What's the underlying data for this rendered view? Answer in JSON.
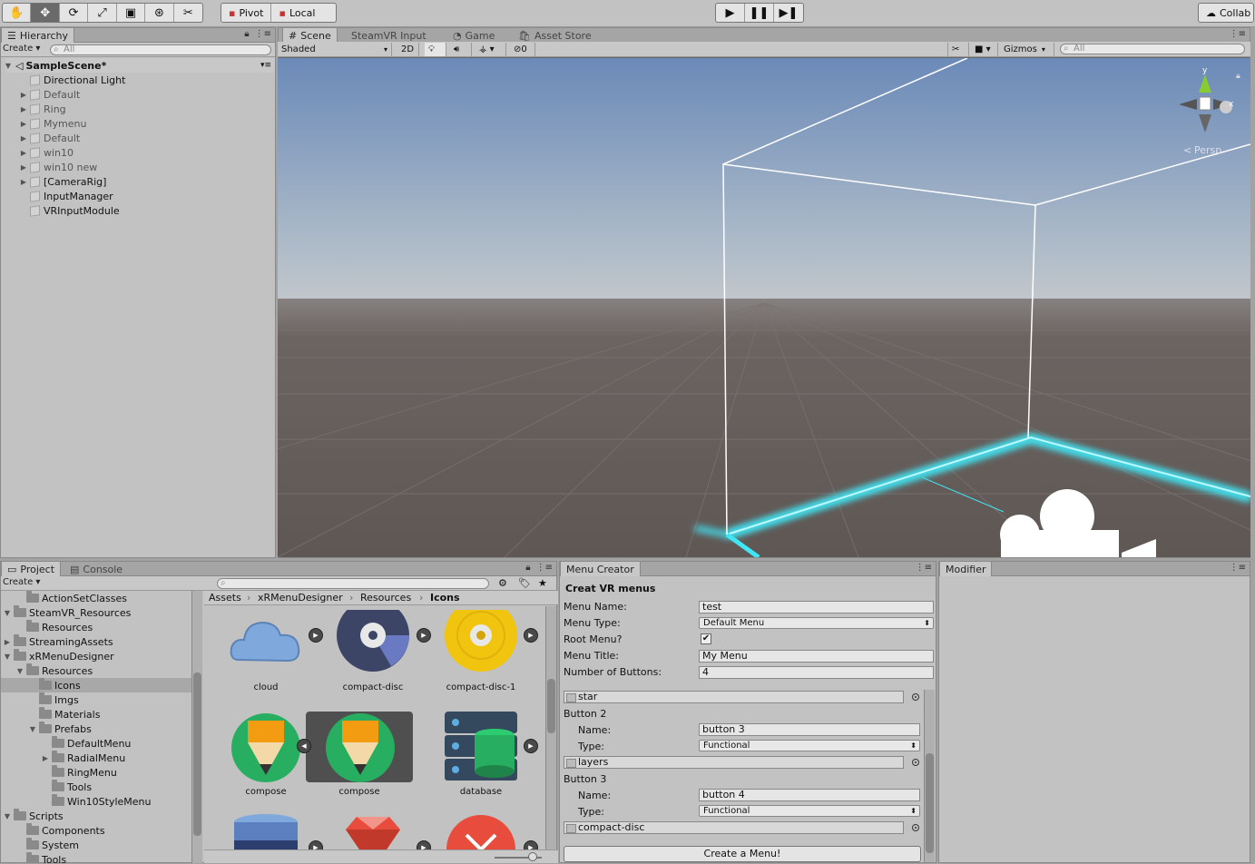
{
  "toolbar": {
    "tools": [
      "hand-tool",
      "move-tool",
      "rotate-tool",
      "scale-tool",
      "rect-tool",
      "transform-tool",
      "custom-tool"
    ],
    "pivot_label": "Pivot",
    "local_label": "Local",
    "collab_label": "Collab"
  },
  "hierarchy": {
    "tab": "Hierarchy",
    "create": "Create",
    "search_placeholder": "All",
    "scene_name": "SampleScene*",
    "items": [
      {
        "label": "Directional Light",
        "arrow": false,
        "active": true
      },
      {
        "label": "Default",
        "arrow": true,
        "active": false
      },
      {
        "label": "Ring",
        "arrow": true,
        "active": false
      },
      {
        "label": "Mymenu",
        "arrow": true,
        "active": false
      },
      {
        "label": "Default",
        "arrow": true,
        "active": false
      },
      {
        "label": "win10",
        "arrow": true,
        "active": false
      },
      {
        "label": "win10 new",
        "arrow": true,
        "active": false
      },
      {
        "label": "[CameraRig]",
        "arrow": true,
        "active": true
      },
      {
        "label": "InputManager",
        "arrow": false,
        "active": true
      },
      {
        "label": "VRInputModule",
        "arrow": false,
        "active": true
      }
    ]
  },
  "scene": {
    "tabs": [
      "Scene",
      "SteamVR Input",
      "Game",
      "Asset Store"
    ],
    "shading": "Shaded",
    "mode_2d": "2D",
    "hidden_count": "0",
    "gizmos": "Gizmos",
    "search_placeholder": "All",
    "persp": "Persp",
    "axis_y": "y",
    "axis_x": "x"
  },
  "project": {
    "tabs": [
      "Project",
      "Console"
    ],
    "create": "Create",
    "breadcrumb": [
      "Assets",
      "xRMenuDesigner",
      "Resources",
      "Icons"
    ],
    "tree": [
      {
        "label": "ActionSetClasses",
        "indent": 2,
        "arrow": ""
      },
      {
        "label": "SteamVR_Resources",
        "indent": 1,
        "arrow": "▼"
      },
      {
        "label": "Resources",
        "indent": 2,
        "arrow": ""
      },
      {
        "label": "StreamingAssets",
        "indent": 1,
        "arrow": "▶"
      },
      {
        "label": "xRMenuDesigner",
        "indent": 1,
        "arrow": "▼"
      },
      {
        "label": "Resources",
        "indent": 2,
        "arrow": "▼"
      },
      {
        "label": "Icons",
        "indent": 3,
        "arrow": "",
        "selected": true
      },
      {
        "label": "Imgs",
        "indent": 3,
        "arrow": ""
      },
      {
        "label": "Materials",
        "indent": 3,
        "arrow": ""
      },
      {
        "label": "Prefabs",
        "indent": 3,
        "arrow": "▼"
      },
      {
        "label": "DefaultMenu",
        "indent": 4,
        "arrow": ""
      },
      {
        "label": "RadialMenu",
        "indent": 4,
        "arrow": "▶"
      },
      {
        "label": "RingMenu",
        "indent": 4,
        "arrow": ""
      },
      {
        "label": "Tools",
        "indent": 4,
        "arrow": ""
      },
      {
        "label": "Win10StyleMenu",
        "indent": 4,
        "arrow": ""
      },
      {
        "label": "Scripts",
        "indent": 1,
        "arrow": "▼"
      },
      {
        "label": "Components",
        "indent": 2,
        "arrow": ""
      },
      {
        "label": "System",
        "indent": 2,
        "arrow": ""
      },
      {
        "label": "Tools",
        "indent": 2,
        "arrow": ""
      }
    ],
    "assets": [
      "cloud",
      "compact-disc",
      "compact-disc-1",
      "compose",
      "compose",
      "database",
      "",
      "",
      ""
    ]
  },
  "menu_creator": {
    "tab": "Menu Creator",
    "heading": "Creat VR menus",
    "menu_name_label": "Menu Name:",
    "menu_name": "test",
    "menu_type_label": "Menu Type:",
    "menu_type": "Default Menu",
    "root_menu_label": "Root Menu?",
    "root_menu_checked": true,
    "menu_title_label": "Menu Title:",
    "menu_title": "My Menu",
    "num_buttons_label": "Number of Buttons:",
    "num_buttons": "4",
    "icon1": "star",
    "button2_label": "Button 2",
    "name_label": "Name:",
    "type_label": "Type:",
    "button2_name": "button 3",
    "button2_type": "Functional",
    "icon2": "layers",
    "button3_label": "Button 3",
    "button3_name": "button 4",
    "button3_type": "Functional",
    "icon3": "compact-disc",
    "create_button": "Create a Menu!"
  },
  "modifier": {
    "tab": "Modifier"
  },
  "colors": {
    "accent": "#3d7bd8",
    "scene_sky_top": "#6d8bb8",
    "scene_ground": "#6a625f",
    "selection_glow": "#3fe6f4"
  }
}
